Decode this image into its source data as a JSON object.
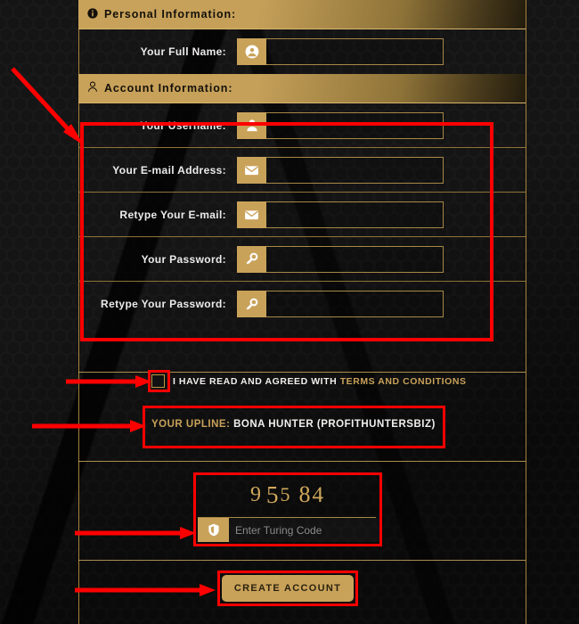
{
  "page": {
    "accent_gold": "#c9a25a",
    "annotation_color": "#ff0000",
    "background": "#141414"
  },
  "sections": [
    {
      "id": "personal-information",
      "title": "Personal Information:",
      "icon": "info-icon"
    },
    {
      "id": "account-information",
      "title": "Account Information:",
      "icon": "user-outline-icon"
    }
  ],
  "fields": {
    "full_name": {
      "label": "Your Full Name:",
      "value": "",
      "placeholder": "",
      "icon": "user-circle-icon"
    },
    "username": {
      "label": "Your Username:",
      "value": "",
      "placeholder": "",
      "icon": "user-icon"
    },
    "email": {
      "label": "Your E-mail Address:",
      "value": "",
      "placeholder": "",
      "icon": "envelope-icon"
    },
    "email_retype": {
      "label": "Retype Your E-mail:",
      "value": "",
      "placeholder": "",
      "icon": "envelope-icon"
    },
    "password": {
      "label": "Your Password:",
      "value": "",
      "placeholder": "",
      "icon": "key-icon"
    },
    "password_retype": {
      "label": "Retype Your Password:",
      "value": "",
      "placeholder": "",
      "icon": "key-icon"
    }
  },
  "terms": {
    "checked": false,
    "text": "I HAVE READ AND AGREED WITH",
    "link_text": "TERMS AND CONDITIONS"
  },
  "upline": {
    "key": "YOUR UPLINE:",
    "value": "BONA HUNTER (PROFITHUNTERSBIZ)"
  },
  "captcha": {
    "code": "95584",
    "digits": [
      "9",
      "5",
      "5",
      "8",
      "4"
    ],
    "input_value": "",
    "placeholder": "Enter Turing Code",
    "icon": "shield-icon"
  },
  "submit": {
    "label": "CREATE ACCOUNT"
  }
}
